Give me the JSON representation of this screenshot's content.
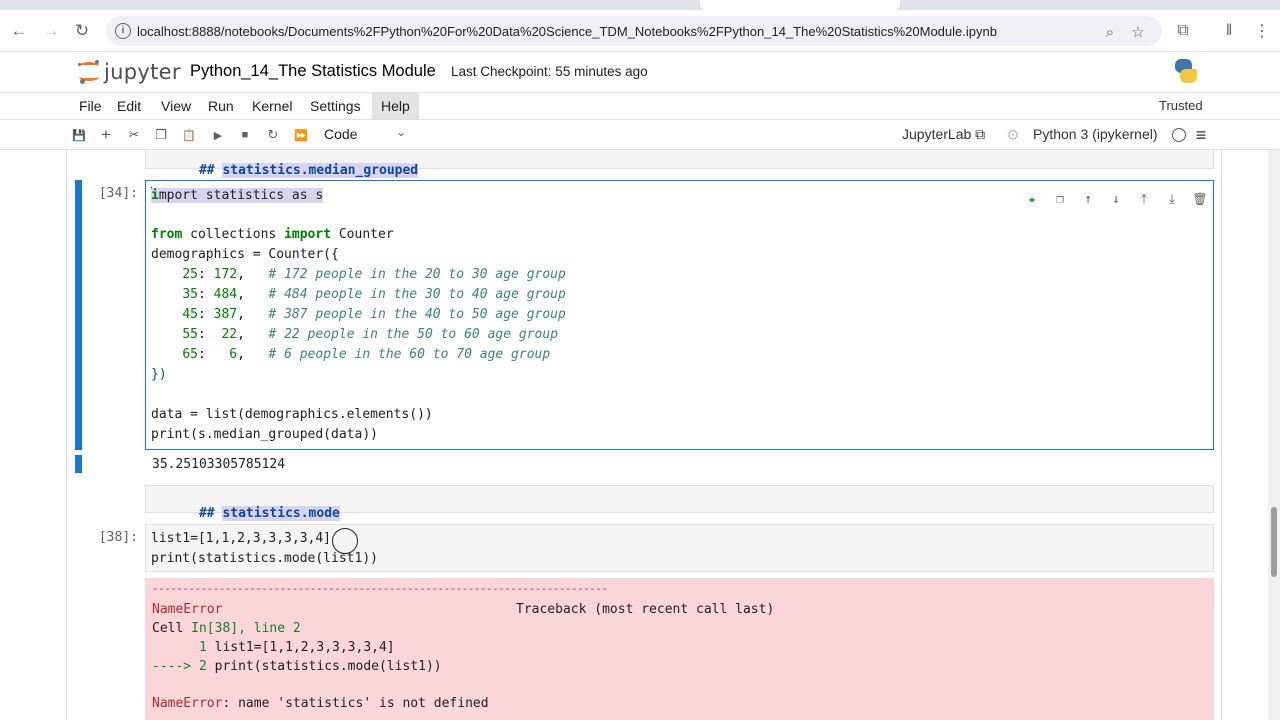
{
  "browser": {
    "url": "localhost:8888/notebooks/Documents%2FPython%20For%20Data%20Science_TDM_Notebooks%2FPython_14_The%20Statistics%20Module.ipynb",
    "back_icon": "←",
    "forward_icon": "→",
    "reload_icon": "↻",
    "info_icon": "i",
    "zoom_icon": "⌕",
    "star_icon": "☆",
    "extensions_icon": "⧉",
    "sidebar_icon": "‖",
    "menu_icon": "⋮"
  },
  "header": {
    "logo_text": "jupyter",
    "notebook_title": "Python_14_The Statistics Module",
    "checkpoint": "Last Checkpoint: 55 minutes ago"
  },
  "menubar": {
    "items": [
      "File",
      "Edit",
      "View",
      "Run",
      "Kernel",
      "Settings",
      "Help"
    ],
    "active": "Help",
    "trusted": "Trusted"
  },
  "toolbar": {
    "save_icon": "💾",
    "add_icon": "+",
    "cut_icon": "✂",
    "copy_icon": "❐",
    "paste_icon": "📋",
    "run_icon": "▶",
    "stop_icon": "■",
    "restart_icon": "↻",
    "run_all_icon": "⏩",
    "cell_type": "Code",
    "cell_type_caret": "⌄",
    "jupyterlab_label": "JupyterLab ⧉",
    "gear_icon": "⚙",
    "kernel_name": "Python 3 (ipykernel)",
    "kernel_menu_icon": "≡"
  },
  "cells": {
    "md1": {
      "hash": "## ",
      "heading": "statistics.median_grouped"
    },
    "code34": {
      "prompt": "[34]:",
      "line1_rest": "mport statistics as s",
      "line1_first": "i",
      "lines": {
        "l3": [
          "from",
          " collections ",
          "import",
          " Counter"
        ],
        "l4": "demographics = Counter({",
        "l5": [
          "    ",
          "25",
          ": ",
          "172",
          ",   ",
          "# 172 people in the 20 to 30 age group"
        ],
        "l6": [
          "    ",
          "35",
          ": ",
          "484",
          ",   ",
          "# 484 people in the 30 to 40 age group"
        ],
        "l7": [
          "    ",
          "45",
          ": ",
          "387",
          ",   ",
          "# 387 people in the 40 to 50 age group"
        ],
        "l8": [
          "    ",
          "55",
          ":  ",
          "22",
          ",   ",
          "# 22 people in the 50 to 60 age group"
        ],
        "l9": [
          "    ",
          "65",
          ":   ",
          "6",
          ",   ",
          "# 6 people in the 60 to 70 age group"
        ],
        "l10": "})",
        "l12": "data = list(demographics.elements())",
        "l13": "print(s.median_grouped(data))"
      },
      "output": "35.25103305785124"
    },
    "md2": {
      "hash": "## ",
      "heading": "statistics.mode"
    },
    "code38": {
      "prompt": "[38]:",
      "line1": "list1=[1,1,2,3,3,3,3,4]",
      "line2": "print(statistics.mode(list1))"
    },
    "error": {
      "dashes": "---------------------------------------------------------------------------",
      "name": "NameError",
      "traceback": "Traceback (most recent call last)",
      "cell_prefix": "Cell ",
      "cell_ref": "In[38], line 2",
      "src1_num": "      1",
      "src1": " list1=[1,1,2,3,3,3,3,4]",
      "arrow": "----> 2",
      "src2": " print(statistics.mode(list1))",
      "msg_name": "NameError",
      "msg": ": name 'statistics' is not defined"
    },
    "tools": {
      "sparkle_icon": "✦",
      "duplicate_icon": "❐",
      "move_up_icon": "↑",
      "move_down_icon": "↓",
      "insert_above_icon": "⤒",
      "insert_below_icon": "⤓",
      "delete_icon": "🗑"
    }
  }
}
